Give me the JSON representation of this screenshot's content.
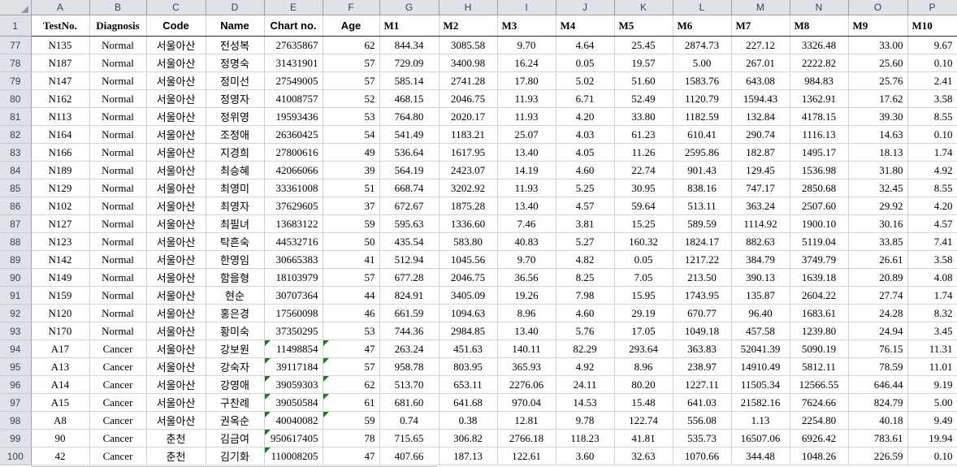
{
  "app": {
    "type": "spreadsheet",
    "corner_label": "select-all"
  },
  "column_headers": [
    "A",
    "B",
    "C",
    "D",
    "E",
    "F",
    "G",
    "H",
    "I",
    "J",
    "K",
    "L",
    "M",
    "N",
    "O",
    "P"
  ],
  "row_headers": [
    "1",
    "77",
    "78",
    "79",
    "80",
    "81",
    "82",
    "83",
    "84",
    "85",
    "86",
    "87",
    "88",
    "89",
    "90",
    "91",
    "92",
    "93",
    "94",
    "95",
    "96",
    "97",
    "98",
    "99",
    "100"
  ],
  "field_names": [
    "TestNo.",
    "Diagnosis",
    "Code",
    "Name",
    "Chart no.",
    "Age",
    "M1",
    "M2",
    "M3",
    "M4",
    "M5",
    "M6",
    "M7",
    "M8",
    "M9",
    "M10"
  ],
  "colors": {
    "header_fill": "#dfe3e8",
    "header_text": "#31425c",
    "grid_line": "#d4d4d4",
    "comment_marker": "#1f7a1f"
  },
  "rows": [
    {
      "row": "77",
      "TestNo.": "N135",
      "Diagnosis": "Normal",
      "Code": "서울아산",
      "Name": "전성복",
      "Chart no.": "27635867",
      "Age": "62",
      "M1": "844.34",
      "M2": "3085.58",
      "M3": "9.70",
      "M4": "4.64",
      "M5": "25.45",
      "M6": "2874.73",
      "M7": "227.12",
      "M8": "3326.48",
      "M9": "33.00",
      "M10": "9.67",
      "flags": []
    },
    {
      "row": "78",
      "TestNo.": "N187",
      "Diagnosis": "Normal",
      "Code": "서울아산",
      "Name": "정명숙",
      "Chart no.": "31431901",
      "Age": "57",
      "M1": "729.09",
      "M2": "3400.98",
      "M3": "16.24",
      "M4": "0.05",
      "M5": "19.57",
      "M6": "5.00",
      "M7": "267.01",
      "M8": "2222.82",
      "M9": "25.60",
      "M10": "0.10",
      "flags": []
    },
    {
      "row": "79",
      "TestNo.": "N147",
      "Diagnosis": "Normal",
      "Code": "서울아산",
      "Name": "정미선",
      "Chart no.": "27549005",
      "Age": "57",
      "M1": "585.14",
      "M2": "2741.28",
      "M3": "17.80",
      "M4": "5.02",
      "M5": "51.60",
      "M6": "1583.76",
      "M7": "643.08",
      "M8": "984.83",
      "M9": "25.76",
      "M10": "2.41",
      "flags": []
    },
    {
      "row": "80",
      "TestNo.": "N162",
      "Diagnosis": "Normal",
      "Code": "서울아산",
      "Name": "정영자",
      "Chart no.": "41008757",
      "Age": "52",
      "M1": "468.15",
      "M2": "2046.75",
      "M3": "11.93",
      "M4": "6.71",
      "M5": "52.49",
      "M6": "1120.79",
      "M7": "1594.43",
      "M8": "1362.91",
      "M9": "17.62",
      "M10": "3.58",
      "flags": []
    },
    {
      "row": "81",
      "TestNo.": "N113",
      "Diagnosis": "Normal",
      "Code": "서울아산",
      "Name": "정위영",
      "Chart no.": "19593436",
      "Age": "53",
      "M1": "764.80",
      "M2": "2020.17",
      "M3": "11.93",
      "M4": "4.20",
      "M5": "33.80",
      "M6": "1182.59",
      "M7": "132.84",
      "M8": "4178.15",
      "M9": "39.30",
      "M10": "8.55",
      "flags": []
    },
    {
      "row": "82",
      "TestNo.": "N164",
      "Diagnosis": "Normal",
      "Code": "서울아산",
      "Name": "조정애",
      "Chart no.": "26360425",
      "Age": "54",
      "M1": "541.49",
      "M2": "1183.21",
      "M3": "25.07",
      "M4": "4.03",
      "M5": "61.23",
      "M6": "610.41",
      "M7": "290.74",
      "M8": "1116.13",
      "M9": "14.63",
      "M10": "0.10",
      "flags": []
    },
    {
      "row": "83",
      "TestNo.": "N166",
      "Diagnosis": "Normal",
      "Code": "서울아산",
      "Name": "지경희",
      "Chart no.": "27800616",
      "Age": "49",
      "M1": "536.64",
      "M2": "1617.95",
      "M3": "13.40",
      "M4": "4.05",
      "M5": "11.26",
      "M6": "2595.86",
      "M7": "182.87",
      "M8": "1495.17",
      "M9": "18.13",
      "M10": "1.74",
      "flags": []
    },
    {
      "row": "84",
      "TestNo.": "N189",
      "Diagnosis": "Normal",
      "Code": "서울아산",
      "Name": "최승혜",
      "Chart no.": "42066066",
      "Age": "39",
      "M1": "564.19",
      "M2": "2423.07",
      "M3": "14.19",
      "M4": "4.60",
      "M5": "22.74",
      "M6": "901.43",
      "M7": "129.45",
      "M8": "1536.98",
      "M9": "31.80",
      "M10": "4.92",
      "flags": []
    },
    {
      "row": "85",
      "TestNo.": "N129",
      "Diagnosis": "Normal",
      "Code": "서울아산",
      "Name": "최영미",
      "Chart no.": "33361008",
      "Age": "51",
      "M1": "668.74",
      "M2": "3202.92",
      "M3": "11.93",
      "M4": "5.25",
      "M5": "30.95",
      "M6": "838.16",
      "M7": "747.17",
      "M8": "2850.68",
      "M9": "32.45",
      "M10": "8.55",
      "flags": []
    },
    {
      "row": "86",
      "TestNo.": "N102",
      "Diagnosis": "Normal",
      "Code": "서울아산",
      "Name": "최영자",
      "Chart no.": "37629605",
      "Age": "37",
      "M1": "672.67",
      "M2": "1875.28",
      "M3": "13.40",
      "M4": "4.57",
      "M5": "59.64",
      "M6": "513.11",
      "M7": "363.24",
      "M8": "2507.60",
      "M9": "29.92",
      "M10": "4.20",
      "flags": []
    },
    {
      "row": "87",
      "TestNo.": "N127",
      "Diagnosis": "Normal",
      "Code": "서울아산",
      "Name": "최필녀",
      "Chart no.": "13683122",
      "Age": "59",
      "M1": "595.63",
      "M2": "1336.60",
      "M3": "7.46",
      "M4": "3.81",
      "M5": "15.25",
      "M6": "589.59",
      "M7": "1114.92",
      "M8": "1900.10",
      "M9": "30.16",
      "M10": "4.57",
      "flags": []
    },
    {
      "row": "88",
      "TestNo.": "N123",
      "Diagnosis": "Normal",
      "Code": "서울아산",
      "Name": "탁흔숙",
      "Chart no.": "44532716",
      "Age": "50",
      "M1": "435.54",
      "M2": "583.80",
      "M3": "40.83",
      "M4": "5.27",
      "M5": "160.32",
      "M6": "1824.17",
      "M7": "882.63",
      "M8": "5119.04",
      "M9": "33.85",
      "M10": "7.41",
      "flags": []
    },
    {
      "row": "89",
      "TestNo.": "N142",
      "Diagnosis": "Normal",
      "Code": "서울아산",
      "Name": "한영임",
      "Chart no.": "30665383",
      "Age": "41",
      "M1": "512.94",
      "M2": "1045.56",
      "M3": "9.70",
      "M4": "4.82",
      "M5": "0.05",
      "M6": "1217.22",
      "M7": "384.79",
      "M8": "3749.79",
      "M9": "26.61",
      "M10": "3.58",
      "flags": []
    },
    {
      "row": "90",
      "TestNo.": "N149",
      "Diagnosis": "Normal",
      "Code": "서울아산",
      "Name": "함을형",
      "Chart no.": "18103979",
      "Age": "57",
      "M1": "677.28",
      "M2": "2046.75",
      "M3": "36.56",
      "M4": "8.25",
      "M5": "7.05",
      "M6": "213.50",
      "M7": "390.13",
      "M8": "1639.18",
      "M9": "20.89",
      "M10": "4.08",
      "flags": []
    },
    {
      "row": "91",
      "TestNo.": "N159",
      "Diagnosis": "Normal",
      "Code": "서울아산",
      "Name": "현순",
      "Chart no.": "30707364",
      "Age": "44",
      "M1": "824.91",
      "M2": "3405.09",
      "M3": "19.26",
      "M4": "7.98",
      "M5": "15.95",
      "M6": "1743.95",
      "M7": "135.87",
      "M8": "2604.22",
      "M9": "27.74",
      "M10": "1.74",
      "flags": []
    },
    {
      "row": "92",
      "TestNo.": "N120",
      "Diagnosis": "Normal",
      "Code": "서울아산",
      "Name": "홍은경",
      "Chart no.": "17560098",
      "Age": "46",
      "M1": "661.59",
      "M2": "1094.63",
      "M3": "8.96",
      "M4": "4.60",
      "M5": "29.19",
      "M6": "670.77",
      "M7": "96.40",
      "M8": "1683.61",
      "M9": "24.28",
      "M10": "8.32",
      "flags": []
    },
    {
      "row": "93",
      "TestNo.": "N170",
      "Diagnosis": "Normal",
      "Code": "서울아산",
      "Name": "황미숙",
      "Chart no.": "37350295",
      "Age": "53",
      "M1": "744.36",
      "M2": "2984.85",
      "M3": "13.40",
      "M4": "5.76",
      "M5": "17.05",
      "M6": "1049.18",
      "M7": "457.58",
      "M8": "1239.80",
      "M9": "24.94",
      "M10": "3.45",
      "flags": []
    },
    {
      "row": "94",
      "TestNo.": "A17",
      "Diagnosis": "Cancer",
      "Code": "서울아산",
      "Name": "강보원",
      "Chart no.": "11498854",
      "Age": "47",
      "M1": "263.24",
      "M2": "451.63",
      "M3": "140.11",
      "M4": "82.29",
      "M5": "293.64",
      "M6": "363.83",
      "M7": "52041.39",
      "M8": "5090.19",
      "M9": "76.15",
      "M10": "11.31",
      "flags": [
        "Chart no.",
        "Age"
      ]
    },
    {
      "row": "95",
      "TestNo.": "A13",
      "Diagnosis": "Cancer",
      "Code": "서울아산",
      "Name": "강숙자",
      "Chart no.": "39117184",
      "Age": "57",
      "M1": "958.78",
      "M2": "803.95",
      "M3": "365.93",
      "M4": "4.92",
      "M5": "8.96",
      "M6": "238.97",
      "M7": "14910.49",
      "M8": "5812.11",
      "M9": "78.59",
      "M10": "11.01",
      "flags": [
        "Chart no.",
        "Age"
      ]
    },
    {
      "row": "96",
      "TestNo.": "A14",
      "Diagnosis": "Cancer",
      "Code": "서울아산",
      "Name": "강영애",
      "Chart no.": "39059303",
      "Age": "62",
      "M1": "513.70",
      "M2": "653.11",
      "M3": "2276.06",
      "M4": "24.11",
      "M5": "80.20",
      "M6": "1227.11",
      "M7": "11505.34",
      "M8": "12566.55",
      "M9": "646.44",
      "M10": "9.19",
      "flags": [
        "Chart no.",
        "Age"
      ]
    },
    {
      "row": "97",
      "TestNo.": "A15",
      "Diagnosis": "Cancer",
      "Code": "서울아산",
      "Name": "구찬례",
      "Chart no.": "39050584",
      "Age": "61",
      "M1": "681.60",
      "M2": "641.68",
      "M3": "970.04",
      "M4": "14.53",
      "M5": "15.48",
      "M6": "641.03",
      "M7": "21582.16",
      "M8": "7624.66",
      "M9": "824.79",
      "M10": "5.00",
      "flags": [
        "Chart no.",
        "Age"
      ]
    },
    {
      "row": "98",
      "TestNo.": "A8",
      "Diagnosis": "Cancer",
      "Code": "서울아산",
      "Name": "권옥순",
      "Chart no.": "40040082",
      "Age": "59",
      "M1": "0.74",
      "M2": "0.38",
      "M3": "12.81",
      "M4": "9.78",
      "M5": "122.74",
      "M6": "556.08",
      "M7": "1.13",
      "M8": "2254.80",
      "M9": "40.18",
      "M10": "9.49",
      "flags": [
        "Chart no.",
        "Age"
      ]
    },
    {
      "row": "99",
      "TestNo.": "90",
      "Diagnosis": "Cancer",
      "Code": "춘천",
      "Name": "김금여",
      "Chart no.": "950617405",
      "Age": "78",
      "M1": "715.65",
      "M2": "306.82",
      "M3": "2766.18",
      "M4": "118.23",
      "M5": "41.81",
      "M6": "535.73",
      "M7": "16507.06",
      "M8": "6926.42",
      "M9": "783.61",
      "M10": "19.94",
      "flags": [
        "Chart no."
      ]
    },
    {
      "row": "100",
      "TestNo.": "42",
      "Diagnosis": "Cancer",
      "Code": "춘천",
      "Name": "김기화",
      "Chart no.": "110008205",
      "Age": "47",
      "M1": "407.66",
      "M2": "187.13",
      "M3": "122.61",
      "M4": "3.60",
      "M5": "32.63",
      "M6": "1070.66",
      "M7": "344.48",
      "M8": "1048.26",
      "M9": "226.59",
      "M10": "0.10",
      "flags": [
        "Chart no."
      ]
    }
  ]
}
